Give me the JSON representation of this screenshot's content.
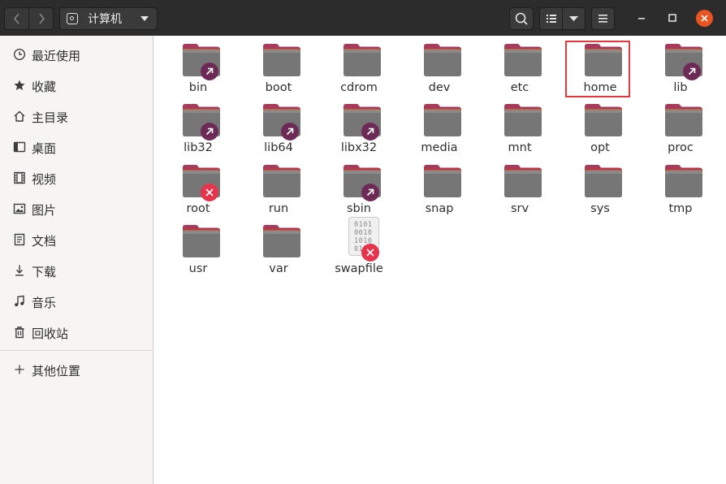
{
  "titlebar": {
    "location_label": "计算机"
  },
  "sidebar": {
    "items": [
      {
        "label": "最近使用",
        "icon": "clock-icon"
      },
      {
        "label": "收藏",
        "icon": "star-icon"
      },
      {
        "label": "主目录",
        "icon": "home-icon"
      },
      {
        "label": "桌面",
        "icon": "desktop-icon"
      },
      {
        "label": "视频",
        "icon": "video-icon"
      },
      {
        "label": "图片",
        "icon": "image-icon"
      },
      {
        "label": "文档",
        "icon": "document-icon"
      },
      {
        "label": "下载",
        "icon": "download-icon"
      },
      {
        "label": "音乐",
        "icon": "music-icon"
      },
      {
        "label": "回收站",
        "icon": "trash-icon"
      }
    ],
    "other_locations": {
      "label": "其他位置",
      "icon": "plus-icon"
    }
  },
  "files": [
    {
      "name": "bin",
      "badge": "link"
    },
    {
      "name": "boot",
      "badge": ""
    },
    {
      "name": "cdrom",
      "badge": ""
    },
    {
      "name": "dev",
      "badge": ""
    },
    {
      "name": "etc",
      "badge": ""
    },
    {
      "name": "home",
      "badge": "",
      "highlighted": true
    },
    {
      "name": "lib",
      "badge": "link"
    },
    {
      "name": "lib32",
      "badge": "link"
    },
    {
      "name": "lib64",
      "badge": "link"
    },
    {
      "name": "libx32",
      "badge": "link"
    },
    {
      "name": "media",
      "badge": ""
    },
    {
      "name": "mnt",
      "badge": ""
    },
    {
      "name": "opt",
      "badge": ""
    },
    {
      "name": "proc",
      "badge": ""
    },
    {
      "name": "root",
      "badge": "noaccess"
    },
    {
      "name": "run",
      "badge": ""
    },
    {
      "name": "sbin",
      "badge": "link"
    },
    {
      "name": "snap",
      "badge": ""
    },
    {
      "name": "srv",
      "badge": ""
    },
    {
      "name": "sys",
      "badge": ""
    },
    {
      "name": "tmp",
      "badge": ""
    },
    {
      "name": "usr",
      "badge": ""
    },
    {
      "name": "var",
      "badge": ""
    },
    {
      "name": "swapfile",
      "badge": "noaccess",
      "type": "file"
    }
  ],
  "swapfile_glyph": [
    "0101",
    "0010",
    "1010",
    "0110"
  ],
  "colors": {
    "titlebar": "#2c2c2c",
    "folder_tab": "#a83a5a",
    "folder_body": "#767676",
    "link_badge": "#6e2a57",
    "noaccess_badge": "#e7334b",
    "close_button": "#e95420",
    "highlight_box": "#e8353b"
  }
}
